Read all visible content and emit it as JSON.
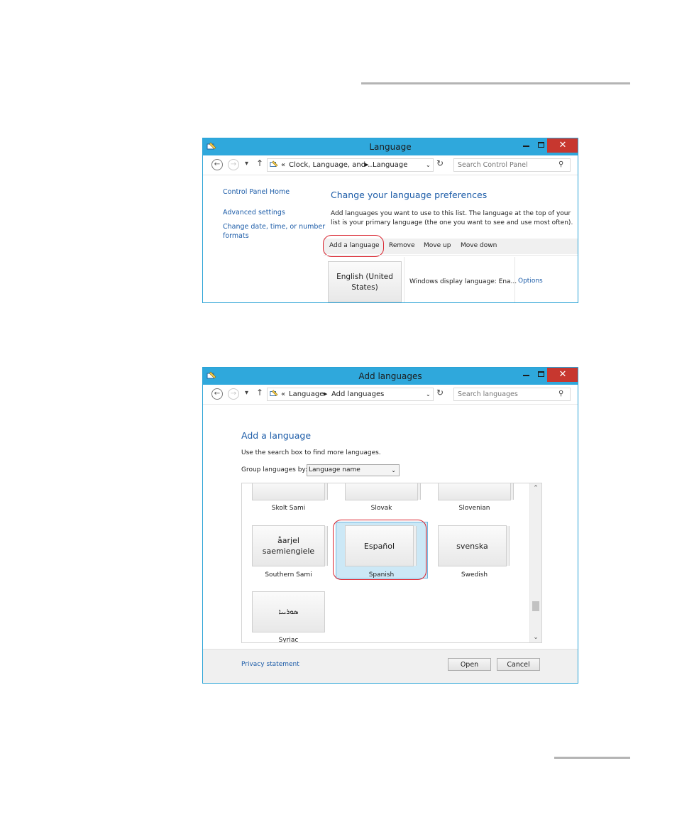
{
  "window1": {
    "title": "Language",
    "breadcrumb": {
      "chevron": "«",
      "part1": "Clock, Language, and ...",
      "part2": "Language"
    },
    "search_placeholder": "Search Control Panel",
    "sidebar": {
      "home": "Control Panel Home",
      "advanced": "Advanced settings",
      "change_date": "Change date, time, or number",
      "change_date_2": "formats"
    },
    "heading": "Change your language preferences",
    "description_1": "Add languages you want to use to this list. The language at the top of your",
    "description_2": "list is your primary language (the one you want to see and use most often).",
    "toolbar": {
      "add": "Add a language",
      "remove": "Remove",
      "move_up": "Move up",
      "move_down": "Move down"
    },
    "language": {
      "tile_1": "English (United",
      "tile_2": "States)",
      "display": "Windows display language: Ena...",
      "options": "Options"
    }
  },
  "window2": {
    "title": "Add languages",
    "breadcrumb": {
      "chevron": "«",
      "part1": "Language",
      "part2": "Add languages"
    },
    "search_placeholder": "Search languages",
    "heading": "Add a language",
    "hint": "Use the search box to find more languages.",
    "group_label": "Group languages by:",
    "group_value": "Language name",
    "languages": [
      {
        "tile": "",
        "name": "Skolt Sami"
      },
      {
        "tile": "",
        "name": "Slovak"
      },
      {
        "tile": "",
        "name": "Slovenian"
      },
      {
        "tile": "åarjel saemiengiele",
        "name": "Southern Sami"
      },
      {
        "tile": "Español",
        "name": "Spanish"
      },
      {
        "tile": "svenska",
        "name": "Swedish"
      },
      {
        "tile": "ܣܘܪܝܝܐ",
        "name": "Syriac"
      }
    ],
    "privacy": "Privacy statement",
    "open_button": "Open",
    "cancel_button": "Cancel"
  },
  "colors": {
    "accent": "#2fa8dc",
    "link": "#1c5ca8",
    "close": "#c7372f",
    "highlight": "#d9232e",
    "selected": "#cce8f6"
  }
}
